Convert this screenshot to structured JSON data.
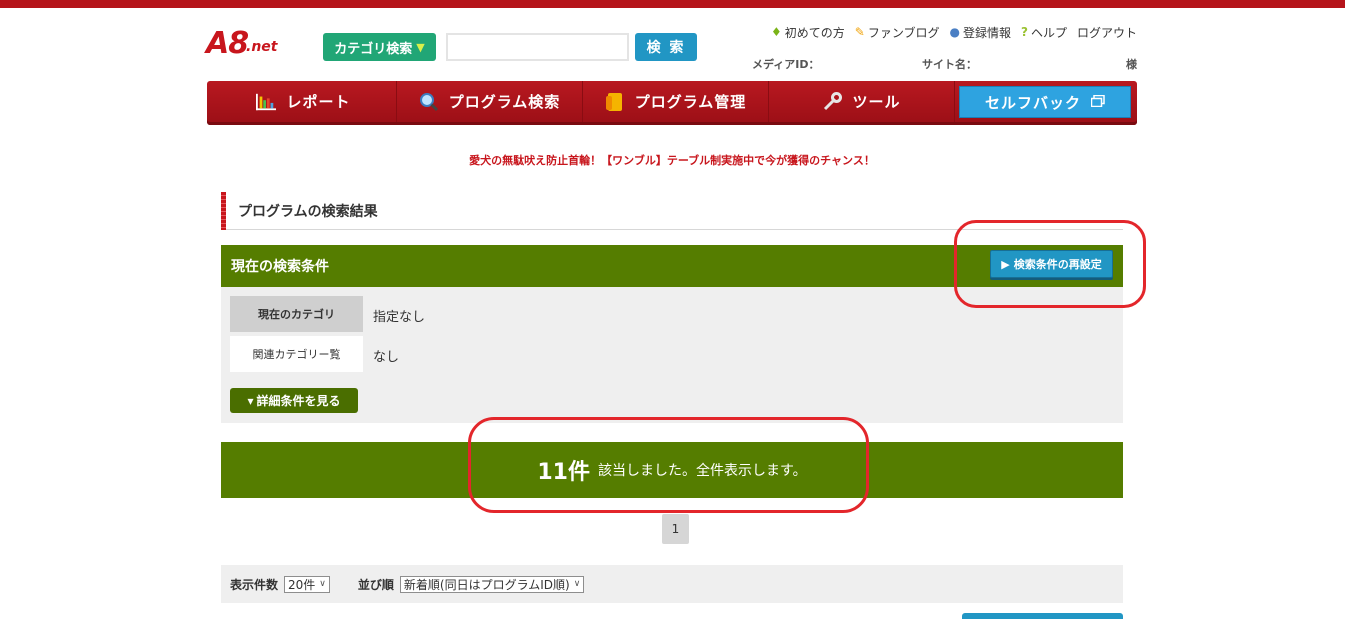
{
  "header": {
    "logo_text": "A8",
    "logo_sub": ".net",
    "category_button": "カテゴリ検索",
    "search_placeholder": "",
    "search_button": "検 索",
    "util_links": [
      "初めての方",
      "ファンブログ",
      "登録情報",
      "ヘルプ",
      "ログアウト"
    ],
    "media_id_label": "メディアID：",
    "site_name_label": "サイト名：",
    "suffix": "様"
  },
  "nav": {
    "items": [
      {
        "label": "レポート",
        "icon": "bar-chart-icon"
      },
      {
        "label": "プログラム検索",
        "icon": "magnifier-icon"
      },
      {
        "label": "プログラム管理",
        "icon": "folder-icon"
      },
      {
        "label": "ツール",
        "icon": "wrench-icon"
      }
    ],
    "selfback": "セルフバック"
  },
  "promo": "愛犬の無駄吠え防止首輪！【ワンブル】テーブル制実施中で今が獲得のチャンス！",
  "section_title": "プログラムの検索結果",
  "conditions": {
    "header": "現在の検索条件",
    "reset_button": "検索条件の再設定",
    "rows": [
      {
        "label": "現在のカテゴリ",
        "value": "指定なし"
      },
      {
        "label": "関連カテゴリー覧",
        "value": "なし"
      }
    ],
    "detail_button": "詳細条件を見る"
  },
  "result": {
    "count": "11件",
    "message": "該当しました。全件表示します。"
  },
  "pager": {
    "current": "1"
  },
  "sort": {
    "per_page_label": "表示件数",
    "per_page_value": "20件",
    "order_label": "並び順",
    "order_value": "新着順(同日はプログラムID順)"
  },
  "colors": {
    "brand_red": "#c8161d",
    "green": "#557d00",
    "blue": "#2196c4",
    "annotation": "#e3262b"
  }
}
